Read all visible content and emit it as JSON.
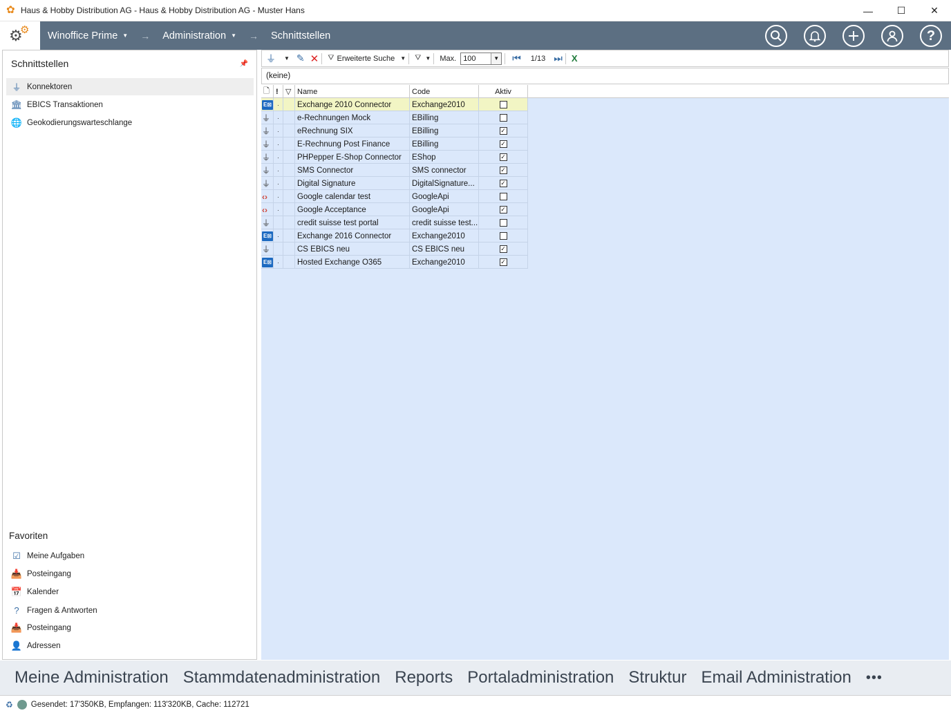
{
  "window": {
    "title": "Haus & Hobby Distribution AG - Haus & Hobby Distribution AG - Muster Hans",
    "minimize": "—",
    "maximize": "☐",
    "close": "✕"
  },
  "header": {
    "breadcrumb": [
      "Winoffice Prime",
      "Administration",
      "Schnittstellen"
    ],
    "buttons": [
      "search-icon",
      "bell-icon",
      "plus-icon",
      "user-icon",
      "help-icon"
    ],
    "color": "#5c6f82"
  },
  "leftpanel": {
    "title": "Schnittstellen",
    "items": [
      {
        "label": "Konnektoren",
        "icon": "plug-icon",
        "selected": true
      },
      {
        "label": "EBICS Transaktionen",
        "icon": "bank-icon",
        "selected": false
      },
      {
        "label": "Geokodierungswarteschlange",
        "icon": "globe-icon",
        "selected": false
      }
    ],
    "favorites_title": "Favoriten",
    "favorites": [
      {
        "label": "Meine Aufgaben",
        "icon": "tasks-icon"
      },
      {
        "label": "Posteingang",
        "icon": "inbox-icon"
      },
      {
        "label": "Kalender",
        "icon": "calendar-icon"
      },
      {
        "label": "Fragen & Antworten",
        "icon": "question-icon"
      },
      {
        "label": "Posteingang",
        "icon": "inbox-icon"
      },
      {
        "label": "Adressen",
        "icon": "contacts-icon"
      }
    ]
  },
  "toolbar": {
    "advanced_search": "Erweiterte Suche",
    "max_label": "Max.",
    "max_value": "100",
    "page": "1/13"
  },
  "filter": {
    "text": "(keine)"
  },
  "grid": {
    "columns": {
      "name": "Name",
      "code": "Code",
      "active": "Aktiv",
      "flag": "!"
    },
    "rows": [
      {
        "icon": "exchange",
        "dot": "·",
        "name": "Exchange 2010 Connector",
        "code": "Exchange2010",
        "active": false,
        "selected": true
      },
      {
        "icon": "plug",
        "dot": "·",
        "name": "e-Rechnungen Mock",
        "code": "EBilling",
        "active": false
      },
      {
        "icon": "plug",
        "dot": "·",
        "name": "eRechnung SIX",
        "code": "EBilling",
        "active": true
      },
      {
        "icon": "plug",
        "dot": "·",
        "name": "E-Rechnung Post Finance",
        "code": "EBilling",
        "active": true
      },
      {
        "icon": "plug",
        "dot": "·",
        "name": "PHPepper E-Shop Connector",
        "code": "EShop",
        "active": true
      },
      {
        "icon": "plug",
        "dot": "·",
        "name": "SMS Connector",
        "code": "SMS connector",
        "active": true
      },
      {
        "icon": "plug",
        "dot": "·",
        "name": "Digital Signature",
        "code": "DigitalSignature...",
        "active": true
      },
      {
        "icon": "google",
        "dot": "·",
        "name": "Google calendar test",
        "code": "GoogleApi",
        "active": false
      },
      {
        "icon": "google",
        "dot": "·",
        "name": "Google Acceptance",
        "code": "GoogleApi",
        "active": true
      },
      {
        "icon": "plug",
        "dot": "",
        "name": "credit suisse test portal",
        "code": "credit suisse test...",
        "active": false
      },
      {
        "icon": "exchange",
        "dot": "·",
        "name": "Exchange 2016 Connector",
        "code": "Exchange2010",
        "active": false
      },
      {
        "icon": "plug",
        "dot": "",
        "name": "CS EBICS neu",
        "code": "CS EBICS neu",
        "active": true
      },
      {
        "icon": "exchange",
        "dot": "·",
        "name": "Hosted Exchange O365",
        "code": "Exchange2010",
        "active": true
      }
    ]
  },
  "bottomnav": {
    "items": [
      "Meine Administration",
      "Stammdatenadministration",
      "Reports",
      "Portaladministration",
      "Struktur",
      "Email Administration",
      "•••"
    ]
  },
  "status": {
    "text": "Gesendet: 17'350KB, Empfangen: 113'320KB, Cache: 112721"
  }
}
